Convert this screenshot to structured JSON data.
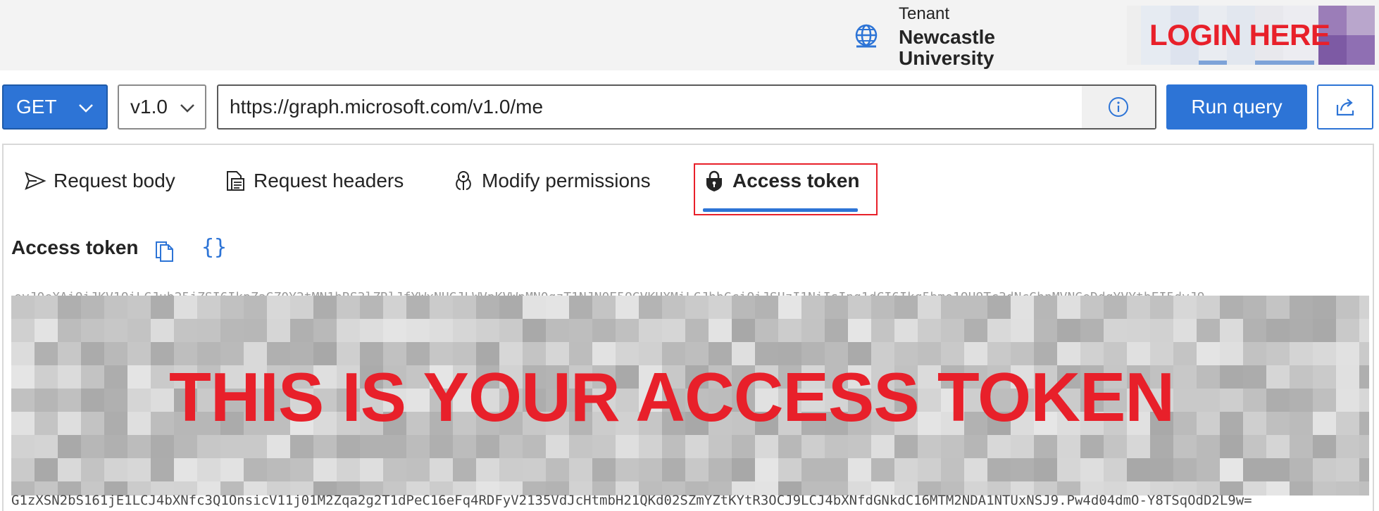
{
  "header": {
    "tenant_label": "Tenant",
    "tenant_name": "Newcastle University",
    "login_banner": "LOGIN HERE"
  },
  "query": {
    "method": "GET",
    "version": "v1.0",
    "url": "https://graph.microsoft.com/v1.0/me",
    "run_label": "Run query"
  },
  "tabs": [
    {
      "label": "Request body",
      "icon": "send-icon"
    },
    {
      "label": "Request headers",
      "icon": "document-icon"
    },
    {
      "label": "Modify permissions",
      "icon": "key-icon"
    },
    {
      "label": "Access token",
      "icon": "lock-shield-icon",
      "active": true
    }
  ],
  "token": {
    "heading": "Access token",
    "value_top": "eyJ0eXAiOiJKV1QiLCJub25jZSI6IkpZaGZ0Y2tMN1hRS3lZRlJfYWxNUGJLWVpKVWpMN0gzT1NJN0E5OGVKUXMiLCJhbGciOiJSUzI1NiIsIng1dCI6Ikg5bmo1QU9Tc3dNcGhnMVNGeDdqYVYtbEI5dyJ9",
    "value_bottom": "G1zXSN2bS161jE1LCJ4bXNfc3Q1OnsicV11j01M2Zqa2g2T1dPeC16eFq4RDFyV2135VdJcHtmbH21QKd02SZmYZtKYtR3OCJ9LCJ4bXNfdGNkdC16MTM2NDA1NTUxNSJ9.Pw4d04dmO-Y8TSqOdD2L9w=",
    "overlay_caption": "THIS IS YOUR ACCESS TOKEN"
  },
  "colors": {
    "accent": "#2d74d6",
    "highlight": "#e8202a"
  }
}
